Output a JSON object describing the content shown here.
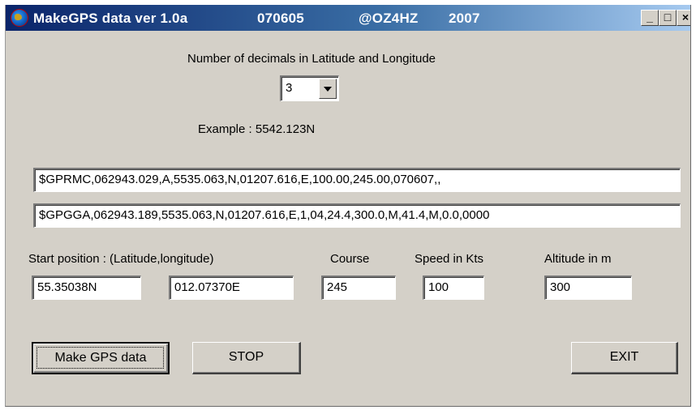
{
  "window": {
    "title_app": "MakeGPS data ver 1.0a",
    "title_date": "070605",
    "title_author": "@OZ4HZ",
    "title_year": "2007",
    "controls": {
      "minimize": "_",
      "maximize": "□",
      "close": "×"
    }
  },
  "decimals": {
    "label": "Number of decimals in Latitude and Longitude",
    "selected": "3",
    "example": "Example : 5542.123N"
  },
  "sentences": {
    "gprmc": "$GPRMC,062943.029,A,5535.063,N,01207.616,E,100.00,245.00,070607,,",
    "gpgga": "$GPGGA,062943.189,5535.063,N,01207.616,E,1,04,24.4,300.0,M,41.4,M,0.0,0000"
  },
  "position": {
    "label": "Start position : (Latitude,longitude)",
    "latitude": "55.35038N",
    "longitude": "012.07370E"
  },
  "course": {
    "label": "Course",
    "value": "245"
  },
  "speed": {
    "label": "Speed in Kts",
    "value": "100"
  },
  "altitude": {
    "label": "Altitude in m",
    "value": "300"
  },
  "buttons": {
    "make": "Make GPS data",
    "stop": "STOP",
    "exit": "EXIT"
  }
}
